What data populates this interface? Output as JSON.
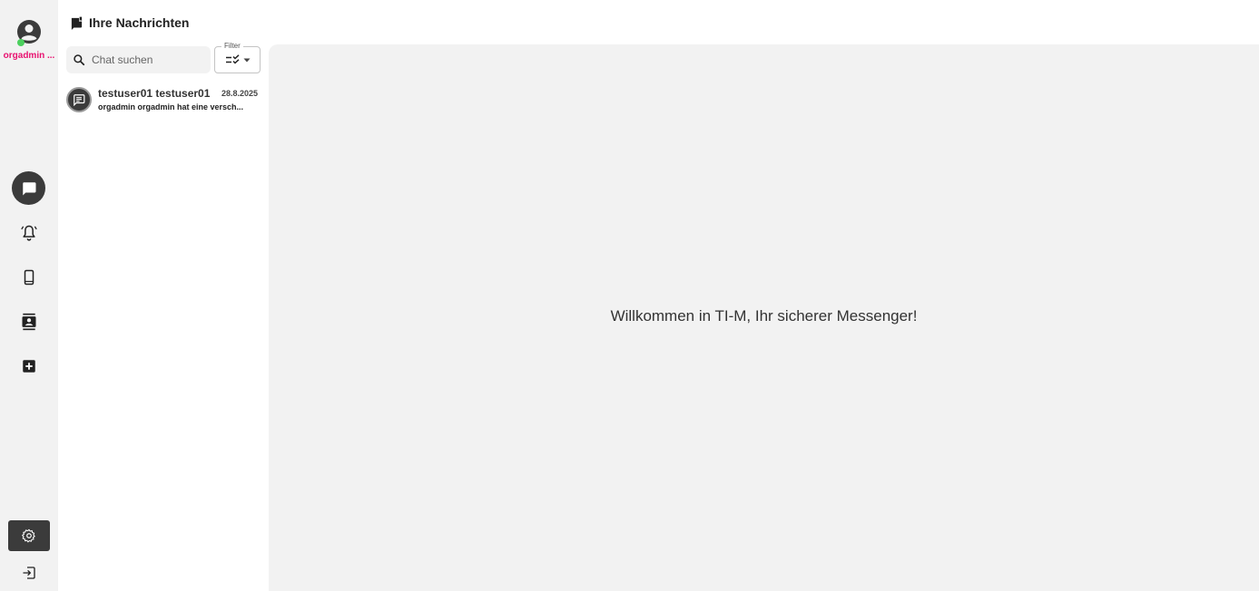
{
  "user": {
    "name": "orgadmin ...",
    "status_color": "#4cd05e"
  },
  "header": {
    "title": "Ihre Nachrichten",
    "icon": "chat-flag-icon"
  },
  "search": {
    "placeholder": "Chat suchen",
    "value": ""
  },
  "filter": {
    "label": "Filter",
    "icon": "filter-checklist-icon"
  },
  "chats": [
    {
      "name": "testuser01 testuser01",
      "date": "28.8.2025",
      "preview": "orgadmin orgadmin hat eine versch..."
    }
  ],
  "nav": [
    {
      "id": "chats",
      "icon": "chat-icon",
      "active": true
    },
    {
      "id": "notifications",
      "icon": "bell-icon",
      "active": false
    },
    {
      "id": "devices",
      "icon": "phone-icon",
      "active": false
    },
    {
      "id": "contacts",
      "icon": "contacts-icon",
      "active": false
    },
    {
      "id": "new",
      "icon": "add-box-icon",
      "active": false
    },
    {
      "id": "settings",
      "icon": "gear-icon",
      "active": false
    },
    {
      "id": "logout",
      "icon": "logout-icon",
      "active": false
    }
  ],
  "main": {
    "welcome": "Willkommen in TI-M, Ihr sicherer Messenger!"
  },
  "colors": {
    "accent_name": "#e8116f",
    "rail_bg": "#f2f2f2",
    "dark_button": "#3b3b3b",
    "panel_bg": "#f2f2f2"
  }
}
